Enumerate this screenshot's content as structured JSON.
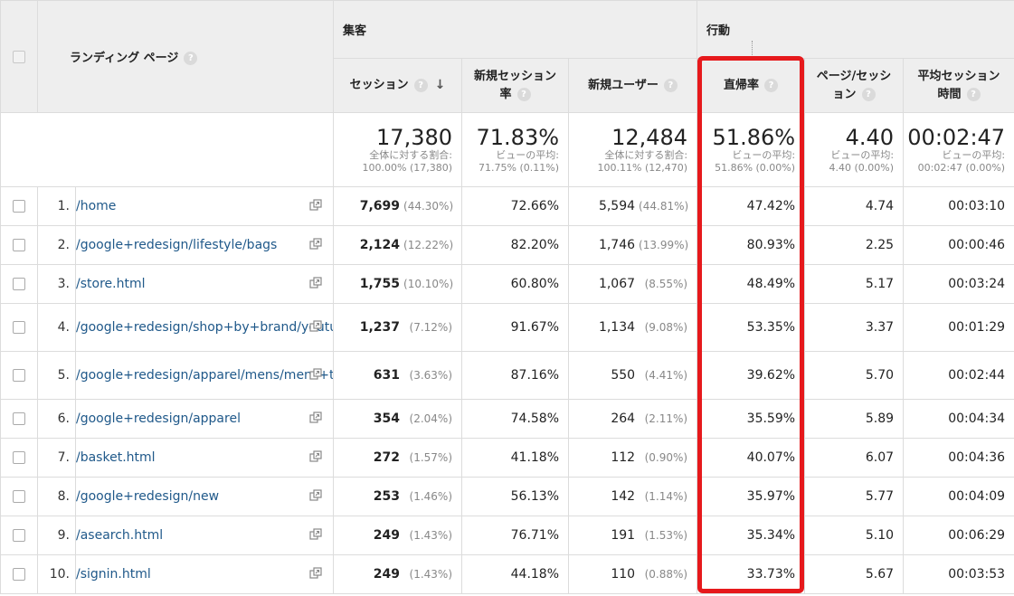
{
  "header": {
    "group_acquisition": "集客",
    "group_behavior": "行動",
    "landing_page": "ランディング ページ",
    "columns": {
      "sessions": "セッション",
      "new_session_rate": [
        "新規セッション",
        "率"
      ],
      "new_users": "新規ユーザー",
      "bounce_rate": "直帰率",
      "pages_per_session": [
        "ページ/セッシ",
        "ョン"
      ],
      "avg_session_duration": [
        "平均セッション",
        "時間"
      ]
    },
    "help": "?",
    "sort_arrow": "↓"
  },
  "totals": {
    "sessions": {
      "value": "17,380",
      "sub1": "全体に対する割合:",
      "sub2": "100.00% (17,380)"
    },
    "new_session_rate": {
      "value": "71.83%",
      "sub1": "ビューの平均:",
      "sub2": "71.75% (0.11%)"
    },
    "new_users": {
      "value": "12,484",
      "sub1": "全体に対する割合:",
      "sub2": "100.11% (12,470)"
    },
    "bounce_rate": {
      "value": "51.86%",
      "sub1": "ビューの平均:",
      "sub2": "51.86% (0.00%)"
    },
    "pages_per_session": {
      "value": "4.40",
      "sub1": "ビューの平均:",
      "sub2": "4.40 (0.00%)"
    },
    "avg_session_duration": {
      "value": "00:02:47",
      "sub1": "ビューの平均:",
      "sub2": "00:02:47 (0.00%)"
    }
  },
  "rows": [
    {
      "idx": "1.",
      "page": "/home",
      "sessions": "7,699",
      "sessions_pct": "(44.30%)",
      "new_session_rate": "72.66%",
      "new_users": "5,594",
      "new_users_pct": "(44.81%)",
      "bounce": "47.42%",
      "pps": "4.74",
      "dur": "00:03:10"
    },
    {
      "idx": "2.",
      "page": "/google+redesign/lifestyle/bags",
      "sessions": "2,124",
      "sessions_pct": "(12.22%)",
      "new_session_rate": "82.20%",
      "new_users": "1,746",
      "new_users_pct": "(13.99%)",
      "bounce": "80.93%",
      "pps": "2.25",
      "dur": "00:00:46"
    },
    {
      "idx": "3.",
      "page": "/store.html",
      "sessions": "1,755",
      "sessions_pct": "(10.10%)",
      "new_session_rate": "60.80%",
      "new_users": "1,067",
      "new_users_pct": "(8.55%)",
      "bounce": "48.49%",
      "pps": "5.17",
      "dur": "00:03:24"
    },
    {
      "idx": "4.",
      "page": "/google+redesign/shop+by+brand/youtube",
      "sessions": "1,237",
      "sessions_pct": "(7.12%)",
      "new_session_rate": "91.67%",
      "new_users": "1,134",
      "new_users_pct": "(9.08%)",
      "bounce": "53.35%",
      "pps": "3.37",
      "dur": "00:01:29"
    },
    {
      "idx": "5.",
      "page": "/google+redesign/apparel/mens/mens+t+shirts",
      "sessions": "631",
      "sessions_pct": "(3.63%)",
      "new_session_rate": "87.16%",
      "new_users": "550",
      "new_users_pct": "(4.41%)",
      "bounce": "39.62%",
      "pps": "5.70",
      "dur": "00:02:44"
    },
    {
      "idx": "6.",
      "page": "/google+redesign/apparel",
      "sessions": "354",
      "sessions_pct": "(2.04%)",
      "new_session_rate": "74.58%",
      "new_users": "264",
      "new_users_pct": "(2.11%)",
      "bounce": "35.59%",
      "pps": "5.89",
      "dur": "00:04:34"
    },
    {
      "idx": "7.",
      "page": "/basket.html",
      "sessions": "272",
      "sessions_pct": "(1.57%)",
      "new_session_rate": "41.18%",
      "new_users": "112",
      "new_users_pct": "(0.90%)",
      "bounce": "40.07%",
      "pps": "6.07",
      "dur": "00:04:36"
    },
    {
      "idx": "8.",
      "page": "/google+redesign/new",
      "sessions": "253",
      "sessions_pct": "(1.46%)",
      "new_session_rate": "56.13%",
      "new_users": "142",
      "new_users_pct": "(1.14%)",
      "bounce": "35.97%",
      "pps": "5.77",
      "dur": "00:04:09"
    },
    {
      "idx": "9.",
      "page": "/asearch.html",
      "sessions": "249",
      "sessions_pct": "(1.43%)",
      "new_session_rate": "76.71%",
      "new_users": "191",
      "new_users_pct": "(1.53%)",
      "bounce": "35.34%",
      "pps": "5.10",
      "dur": "00:06:29"
    },
    {
      "idx": "10.",
      "page": "/signin.html",
      "sessions": "249",
      "sessions_pct": "(1.43%)",
      "new_session_rate": "44.18%",
      "new_users": "110",
      "new_users_pct": "(0.88%)",
      "bounce": "33.73%",
      "pps": "5.67",
      "dur": "00:03:53"
    }
  ],
  "colors": {
    "link": "#20598a",
    "highlight": "#e6191c",
    "header_bg": "#eeeeee"
  },
  "icons": {
    "row_link": "open-in-new-window-icon",
    "help": "help-circle-icon",
    "sort": "sort-desc-arrow-icon"
  }
}
